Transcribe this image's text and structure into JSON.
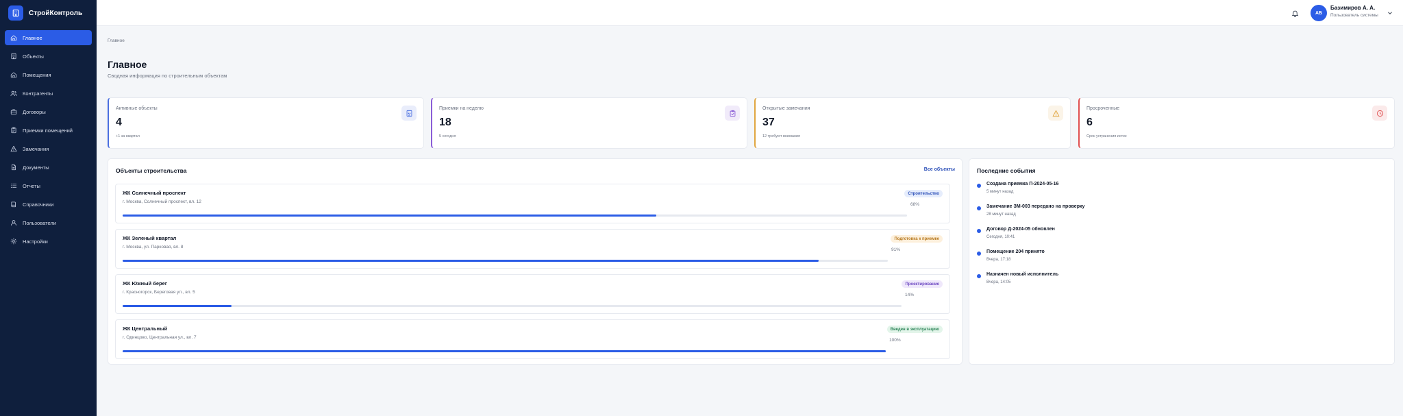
{
  "app": {
    "brand": "СтройКонтроль",
    "accent": "#2b5ce6"
  },
  "sidebar": {
    "items": [
      {
        "label": "Главное",
        "icon": "home-icon",
        "active": true
      },
      {
        "label": "Объекты",
        "icon": "building-icon"
      },
      {
        "label": "Помещения",
        "icon": "home-icon"
      },
      {
        "label": "Контрагенты",
        "icon": "users-icon"
      },
      {
        "label": "Договоры",
        "icon": "briefcase-icon"
      },
      {
        "label": "Приемки помещений",
        "icon": "clipboard-icon"
      },
      {
        "label": "Замечания",
        "icon": "warning-icon"
      },
      {
        "label": "Документы",
        "icon": "document-icon"
      },
      {
        "label": "Отчеты",
        "icon": "list-icon"
      },
      {
        "label": "Справочники",
        "icon": "book-icon"
      },
      {
        "label": "Пользователи",
        "icon": "user-icon"
      },
      {
        "label": "Настройки",
        "icon": "gear-icon"
      }
    ]
  },
  "topbar": {
    "user": {
      "initials": "АБ",
      "name": "Базимиров А. А.",
      "role": "Пользователь системы"
    }
  },
  "header": {
    "breadcrumb": "Главное",
    "title": "Главное",
    "subtitle": "Сводная информация по строительным объектам"
  },
  "stats": [
    {
      "label": "Активные объекты",
      "value": "4",
      "note": "+1 за квартал",
      "color": "#4a6fe0",
      "icon": "building-icon"
    },
    {
      "label": "Приемки на неделю",
      "value": "18",
      "note": "5 сегодня",
      "color": "#8a5cd6",
      "icon": "clipboard-check-icon"
    },
    {
      "label": "Открытые замечания",
      "value": "37",
      "note": "12 требуют внимания",
      "color": "#e0a640",
      "icon": "warning-icon"
    },
    {
      "label": "Просроченные",
      "value": "6",
      "note": "Срок устранения истек",
      "color": "#e05050",
      "icon": "clock-icon"
    }
  ],
  "objects": {
    "title": "Объекты строительства",
    "link": "Все объекты",
    "items": [
      {
        "name": "ЖК Солнечный проспект",
        "address": "г. Москва, Солнечный проспект, вл. 12",
        "status": "Строительство",
        "status_color": "#2b4fb8",
        "status_bg": "#e6edfc",
        "progress": 68,
        "progress_label": "68%"
      },
      {
        "name": "ЖК Зеленый квартал",
        "address": "г. Москва, ул. Парковая, вл. 8",
        "status": "Подготовка к приемке",
        "status_color": "#b7791f",
        "status_bg": "#fdf0dc",
        "progress": 91,
        "progress_label": "91%"
      },
      {
        "name": "ЖК Южный берег",
        "address": "г. Красногорск, Береговая ул., вл. 5",
        "status": "Проектирование",
        "status_color": "#6b46c1",
        "status_bg": "#efe8fb",
        "progress": 14,
        "progress_label": "14%"
      },
      {
        "name": "ЖК Центральный",
        "address": "г. Одинцово, Центральная ул., вл. 7",
        "status": "Введен в эксплуатацию",
        "status_color": "#2f855a",
        "status_bg": "#e3f5ea",
        "progress": 100,
        "progress_label": "100%"
      }
    ]
  },
  "events": {
    "title": "Последние события",
    "items": [
      {
        "title": "Создана приемка П-2024-05-16",
        "time": "5 минут назад"
      },
      {
        "title": "Замечание ЗМ-003 передано на проверку",
        "time": "28 минут назад"
      },
      {
        "title": "Договор Д-2024-05 обновлен",
        "time": "Сегодня, 10:41"
      },
      {
        "title": "Помещение 204 принято",
        "time": "Вчера, 17:18"
      },
      {
        "title": "Назначен новый исполнитель",
        "time": "Вчера, 14:05"
      }
    ]
  }
}
